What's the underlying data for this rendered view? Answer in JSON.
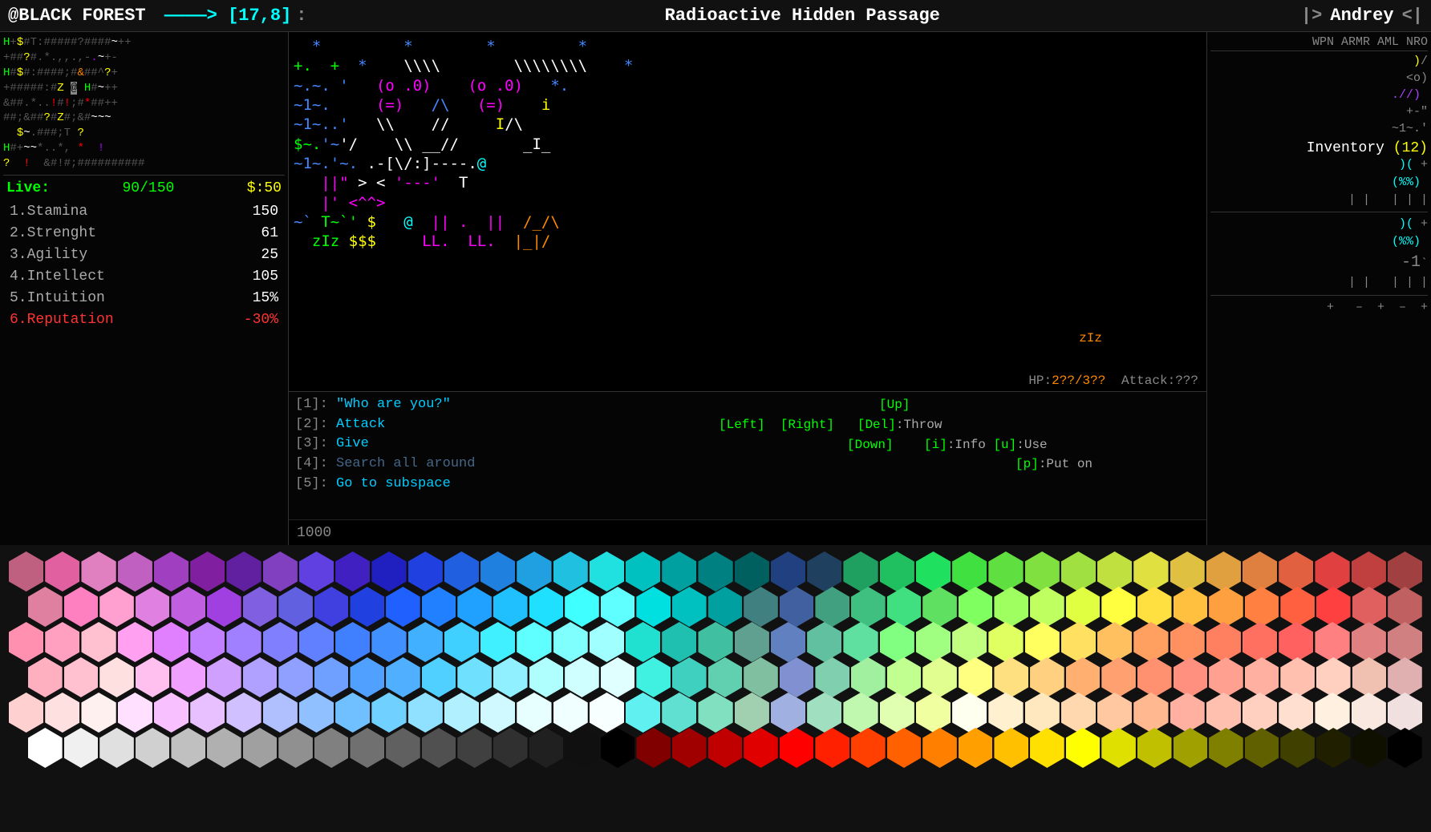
{
  "topbar": {
    "location": "@BLACK FOREST",
    "arrow": "–––>",
    "coords": "[17,8]",
    "passage": "Radioactive Hidden Passage",
    "separator": "|>",
    "player": "Andrey",
    "close": "<|"
  },
  "right_header": {
    "labels": "WPN  ARMR  AML  NRO"
  },
  "inventory": {
    "label": "Inventory",
    "count": "(12)"
  },
  "hp": {
    "label": "HP",
    "value": "2??/3??",
    "attack_label": "Attack",
    "attack_value": "???"
  },
  "stats": {
    "live_label": "Live:",
    "live_val": "90/150",
    "money_label": "$",
    "money_val": "50",
    "rows": [
      {
        "num": "1",
        "name": "Stamina",
        "val": "150"
      },
      {
        "num": "2",
        "name": "Strenght",
        "val": "61"
      },
      {
        "num": "3",
        "name": "Agility",
        "val": "25"
      },
      {
        "num": "4",
        "name": "Intellect",
        "val": "105"
      },
      {
        "num": "5",
        "name": "Intuition",
        "val": "15%"
      },
      {
        "num": "6",
        "name": "Reputation",
        "val": "-30%"
      }
    ]
  },
  "actions": [
    {
      "num": "[1]",
      "text": "\"Who are you?\""
    },
    {
      "num": "[2]",
      "text": "Attack"
    },
    {
      "num": "[3]",
      "text": "Give"
    },
    {
      "num": "[4]",
      "text": "Search all around",
      "dim": true
    },
    {
      "num": "[5]",
      "text": "Go to subspace"
    }
  ],
  "key_hints": [
    {
      "key": "[Up]",
      "label": ""
    },
    {
      "key": "[Left]",
      "label": "  [Right]"
    },
    {
      "key": "[Down]",
      "label": ""
    },
    {
      "key": "[Del]",
      "label": ":Throw"
    },
    {
      "key": "[i]",
      "label": ":Info  [u]:Use"
    },
    {
      "key": "[p]",
      "label": ":Put on"
    }
  ],
  "bottom_num": "1000",
  "palette": {
    "rows": [
      [
        "#c06080",
        "#e060a0",
        "#e080c0",
        "#c060c0",
        "#a040c0",
        "#8020a0",
        "#6020a0",
        "#8040c0",
        "#6040e0",
        "#4020c0",
        "#2020c0",
        "#2040e0",
        "#2060e0",
        "#2080e0",
        "#20a0e0",
        "#20c0e0",
        "#20e0e0",
        "#00c0c0",
        "#00a0a0",
        "#008080",
        "#006060",
        "#204080",
        "#204060",
        "#20a060",
        "#20c060",
        "#20e060",
        "#40e040",
        "#60e040",
        "#80e040",
        "#a0e040",
        "#c0e040",
        "#e0e040",
        "#e0c040",
        "#e0a040",
        "#e08040",
        "#e06040",
        "#e04040",
        "#c04040",
        "#a04040"
      ],
      [
        "#e080a0",
        "#ff80c0",
        "#ffa0d0",
        "#e080e0",
        "#c060e0",
        "#a040e0",
        "#8060e0",
        "#6060e0",
        "#4040e0",
        "#2040e0",
        "#2060ff",
        "#2080ff",
        "#20a0ff",
        "#20c0ff",
        "#20e0ff",
        "#40ffff",
        "#60ffff",
        "#00e0e0",
        "#00c0c0",
        "#00a0a0",
        "#408080",
        "#4060a0",
        "#40a080",
        "#40c080",
        "#40e080",
        "#60e060",
        "#80ff60",
        "#a0ff60",
        "#c0ff60",
        "#e0ff40",
        "#ffff40",
        "#ffe040",
        "#ffc040",
        "#ffa040",
        "#ff8040",
        "#ff6040",
        "#ff4040",
        "#e06060",
        "#c06060"
      ],
      [
        "#ff90b0",
        "#ffa0c0",
        "#ffc0d0",
        "#ffa0f0",
        "#e080ff",
        "#c080ff",
        "#a080ff",
        "#8080ff",
        "#6080ff",
        "#4080ff",
        "#4090ff",
        "#40b0ff",
        "#40d0ff",
        "#40f0ff",
        "#60ffff",
        "#80ffff",
        "#a0ffff",
        "#20e0d0",
        "#20c0b0",
        "#40c0a0",
        "#60a090",
        "#6080c0",
        "#60c0a0",
        "#60e0a0",
        "#80ff80",
        "#a0ff80",
        "#c0ff80",
        "#e0ff60",
        "#ffff60",
        "#ffe060",
        "#ffc060",
        "#ffa060",
        "#ff9060",
        "#ff8060",
        "#ff7060",
        "#ff6060",
        "#ff8080",
        "#e08080",
        "#d08080"
      ],
      [
        "#ffb0c0",
        "#ffc0d0",
        "#ffe0e0",
        "#ffc0f0",
        "#f0a0ff",
        "#d0a0ff",
        "#b0a0ff",
        "#90a0ff",
        "#70a0ff",
        "#50a0ff",
        "#50b0ff",
        "#50d0ff",
        "#70e0ff",
        "#90f0ff",
        "#b0ffff",
        "#d0ffff",
        "#e0ffff",
        "#40f0e0",
        "#40d0c0",
        "#60d0b0",
        "#80c0a0",
        "#8090d0",
        "#80d0b0",
        "#a0f0a0",
        "#c0ff90",
        "#e0ff90",
        "#ffff80",
        "#ffe080",
        "#ffd080",
        "#ffb070",
        "#ffa070",
        "#ff9070",
        "#ff9080",
        "#ffa090",
        "#ffb0a0",
        "#ffc0b0",
        "#ffd0c0",
        "#f0c0b0",
        "#e0b0b0"
      ],
      [
        "#ffd0d0",
        "#ffe0e0",
        "#fff0f0",
        "#ffe0ff",
        "#f8c0ff",
        "#e8c0ff",
        "#d0c0ff",
        "#b0c0ff",
        "#90c0ff",
        "#70c0ff",
        "#70d0ff",
        "#90e0ff",
        "#b0f0ff",
        "#d0f8ff",
        "#e8ffff",
        "#f0ffff",
        "#f8ffff",
        "#60f0f0",
        "#60e0d0",
        "#80e0c0",
        "#a0d0b0",
        "#a0b0e0",
        "#a0e0c0",
        "#c0f8b0",
        "#e0ffb0",
        "#f0ffa0",
        "#fffff0",
        "#fff0d0",
        "#ffe8c0",
        "#ffd8b0",
        "#ffc8a0",
        "#ffb890",
        "#ffb0a0",
        "#ffc0b0",
        "#ffd0c0",
        "#ffe0d0",
        "#fff0e0",
        "#f8e8e0",
        "#f0e0e0"
      ],
      [
        "#ffffff",
        "#f0f0f0",
        "#e0e0e0",
        "#d0d0d0",
        "#c0c0c0",
        "#b0b0b0",
        "#a0a0a0",
        "#909090",
        "#808080",
        "#707070",
        "#606060",
        "#505050",
        "#404040",
        "#303030",
        "#202020",
        "#101010",
        "#000000",
        "#800000",
        "#a00000",
        "#c00000",
        "#e00000",
        "#ff0000",
        "#ff2000",
        "#ff4000",
        "#ff6000",
        "#ff8000",
        "#ffa000",
        "#ffc000",
        "#ffe000",
        "#ffff00",
        "#e0e000",
        "#c0c000",
        "#a0a000",
        "#808000",
        "#606000",
        "#404000",
        "#202000",
        "#101000",
        "#000000"
      ]
    ]
  }
}
